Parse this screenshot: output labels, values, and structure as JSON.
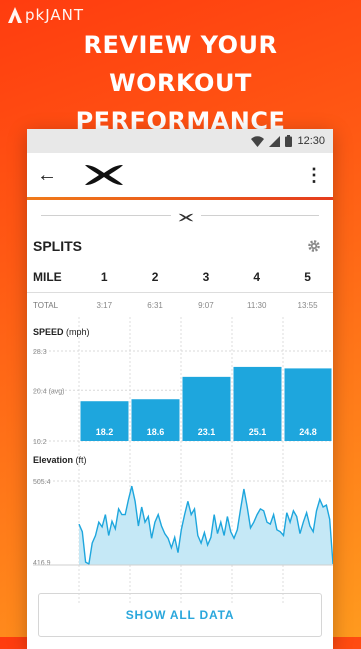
{
  "watermark": {
    "text": "pkJANT"
  },
  "hero": {
    "line1": "REVIEW YOUR",
    "line2": "WORKOUT PERFORMANCE"
  },
  "status_bar": {
    "time": "12:30"
  },
  "app_bar": {
    "back_icon": "arrow-left-icon",
    "logo_icon": "under-armour-logo",
    "menu_icon": "more-vert-icon"
  },
  "colors": {
    "accent": "#2aa7dc",
    "bar": "#1ea6dd",
    "elevation_fill": "#c5e8f6",
    "elevation_line": "#1ea6dd"
  },
  "splits": {
    "title": "SPLITS",
    "settings_icon": "gear-icon",
    "mile_label": "MILE",
    "total_label": "TOTAL",
    "miles": [
      "1",
      "2",
      "3",
      "4",
      "5"
    ],
    "totals": [
      "3:17",
      "6:31",
      "9:07",
      "11:30",
      "13:55"
    ]
  },
  "chart_data": [
    {
      "type": "bar",
      "title": "SPEED",
      "unit": "(mph)",
      "categories": [
        "1",
        "2",
        "3",
        "4",
        "5"
      ],
      "values": [
        18.2,
        18.6,
        23.1,
        25.1,
        24.8
      ],
      "y_ticks": [
        "28.3",
        "20.4 (avg)",
        "10.2"
      ],
      "ylim": [
        10.2,
        28.3
      ],
      "avg": 20.4
    },
    {
      "type": "area",
      "title": "Elevation",
      "unit": "(ft)",
      "ylim": [
        416.9,
        505.4
      ],
      "y_ticks": [
        "505.4",
        "416.9"
      ],
      "values": [
        460,
        452,
        420,
        418,
        440,
        448,
        462,
        457,
        470,
        448,
        463,
        455,
        476,
        470,
        470,
        486,
        500,
        484,
        458,
        478,
        462,
        468,
        445,
        462,
        470,
        458,
        450,
        445,
        435,
        446,
        430,
        454,
        470,
        484,
        470,
        476,
        448,
        440,
        451,
        438,
        446,
        470,
        450,
        462,
        448,
        468,
        452,
        445,
        454,
        476,
        497,
        478,
        456,
        462,
        470,
        476,
        474,
        462,
        460,
        470,
        454,
        452,
        448,
        472,
        462,
        474,
        468,
        450,
        462,
        472,
        458,
        452,
        474,
        486,
        478,
        480,
        465,
        418
      ]
    }
  ],
  "footer": {
    "show_all_label": "SHOW ALL DATA"
  }
}
